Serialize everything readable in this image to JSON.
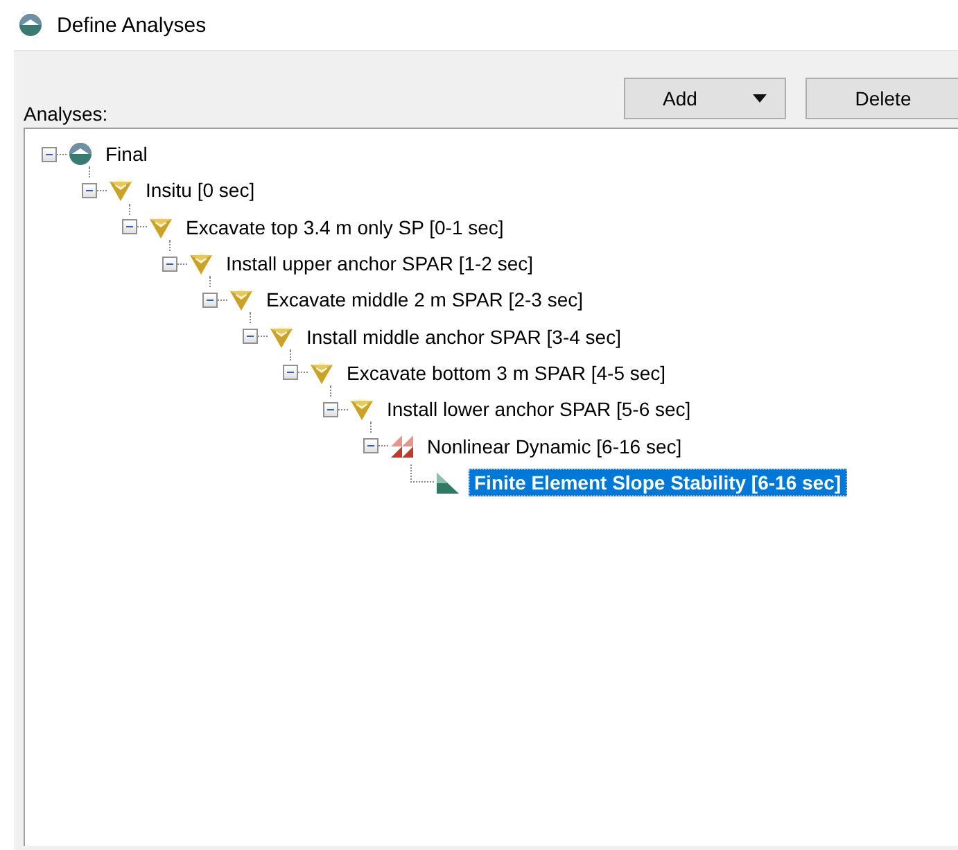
{
  "window": {
    "title": "Define Analyses"
  },
  "buttons": [
    {
      "label": "Add",
      "kind": "dropdown"
    },
    {
      "label": "Delete",
      "kind": "plain"
    }
  ],
  "tree": {
    "label": "Analyses:",
    "items": [
      {
        "label": "Final",
        "kind": "model",
        "expanded": true,
        "selected": false,
        "children": [
          {
            "label": "Insitu [0 sec]",
            "kind": "stage",
            "expanded": true,
            "selected": false,
            "children": [
              {
                "label": "Excavate top 3.4 m only SP [0-1 sec]",
                "kind": "stage",
                "expanded": true,
                "selected": false,
                "children": [
                  {
                    "label": "Install upper anchor SPAR [1-2 sec]",
                    "kind": "stage",
                    "expanded": true,
                    "selected": false,
                    "children": [
                      {
                        "label": "Excavate middle 2 m SPAR [2-3 sec]",
                        "kind": "stage",
                        "expanded": true,
                        "selected": false,
                        "children": [
                          {
                            "label": "Install middle anchor SPAR [3-4 sec]",
                            "kind": "stage",
                            "expanded": true,
                            "selected": false,
                            "children": [
                              {
                                "label": "Excavate bottom 3 m SPAR [4-5 sec]",
                                "kind": "stage",
                                "expanded": true,
                                "selected": false,
                                "children": [
                                  {
                                    "label": "Install lower anchor SPAR [5-6 sec]",
                                    "kind": "stage",
                                    "expanded": true,
                                    "selected": false,
                                    "children": [
                                      {
                                        "label": "Nonlinear Dynamic [6-16 sec]",
                                        "kind": "dynamic",
                                        "expanded": true,
                                        "selected": false,
                                        "children": [
                                          {
                                            "label": "Finite Element Slope Stability [6-16 sec]",
                                            "kind": "slope",
                                            "selected": true
                                          }
                                        ]
                                      }
                                    ]
                                  }
                                ]
                              }
                            ]
                          }
                        ]
                      }
                    ]
                  }
                ]
              }
            ]
          }
        ]
      }
    ]
  }
}
